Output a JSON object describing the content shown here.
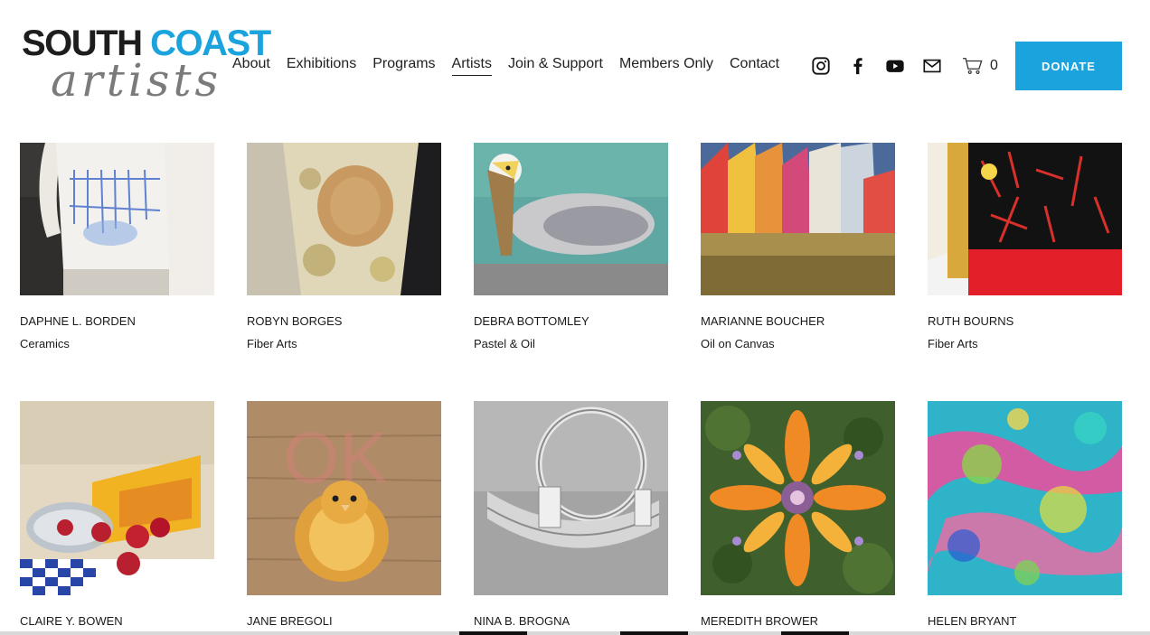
{
  "brand": {
    "logo_line1_a": "SOUTH",
    "logo_line1_b": "COAST",
    "logo_line2": "artists",
    "accent": "#1aa3dc"
  },
  "nav": {
    "items": [
      {
        "label": "About"
      },
      {
        "label": "Exhibitions"
      },
      {
        "label": "Programs"
      },
      {
        "label": "Artists",
        "active": true
      },
      {
        "label": "Join & Support"
      },
      {
        "label": "Members Only"
      },
      {
        "label": "Contact"
      }
    ]
  },
  "social": [
    "instagram-icon",
    "facebook-icon",
    "youtube-icon",
    "email-icon"
  ],
  "cart": {
    "count": "0"
  },
  "donate": {
    "label": "DONATE"
  },
  "artists": [
    {
      "name": "DAPHNE L. BORDEN",
      "medium": "Ceramics"
    },
    {
      "name": "ROBYN BORGES",
      "medium": "Fiber Arts"
    },
    {
      "name": "DEBRA BOTTOMLEY",
      "medium": "Pastel & Oil"
    },
    {
      "name": "MARIANNE BOUCHER",
      "medium": "Oil on Canvas"
    },
    {
      "name": "RUTH BOURNS",
      "medium": "Fiber Arts"
    },
    {
      "name": "CLAIRE Y. BOWEN",
      "medium": ""
    },
    {
      "name": "JANE BREGOLI",
      "medium": ""
    },
    {
      "name": "NINA B. BROGNA",
      "medium": ""
    },
    {
      "name": "MEREDITH BROWER",
      "medium": ""
    },
    {
      "name": "HELEN BRYANT",
      "medium": ""
    }
  ]
}
